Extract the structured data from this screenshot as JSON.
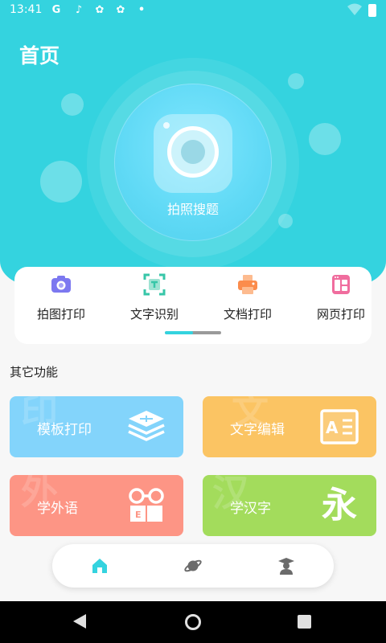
{
  "status_bar": {
    "time": "13:41",
    "notifications": [
      "google-icon",
      "tiktok-icon",
      "app-icon",
      "app-icon",
      "dot"
    ]
  },
  "header": {
    "title": "首页"
  },
  "camera_search": {
    "label": "拍照搜题"
  },
  "features": [
    {
      "label": "拍图打印",
      "icon": "camera-icon",
      "color": "#7c78f0"
    },
    {
      "label": "文字识别",
      "icon": "text-scan-icon",
      "color": "#37c6a8"
    },
    {
      "label": "文档打印",
      "icon": "printer-icon",
      "color": "#fb8c4c"
    },
    {
      "label": "网页打印",
      "icon": "webpage-icon",
      "color": "#f06d9e"
    }
  ],
  "other": {
    "title": "其它功能",
    "tiles": [
      {
        "label": "模板打印",
        "watermark": "印",
        "icon": "template-icon",
        "color": "#83d4fb"
      },
      {
        "label": "文字编辑",
        "watermark": "文",
        "icon": "text-edit-icon",
        "color": "#fbc463"
      },
      {
        "label": "学外语",
        "watermark": "外",
        "icon": "glasses-book-icon",
        "color": "#fd9585"
      },
      {
        "label": "学汉字",
        "watermark": "汉",
        "icon": "yong-char-icon",
        "color": "#a3dc5c",
        "glyph": "永"
      }
    ]
  },
  "tabbar": {
    "active_color": "#34d3df",
    "tabs": [
      "home-icon",
      "planet-icon",
      "graduate-icon"
    ]
  },
  "colors": {
    "primary": "#34d3df"
  }
}
